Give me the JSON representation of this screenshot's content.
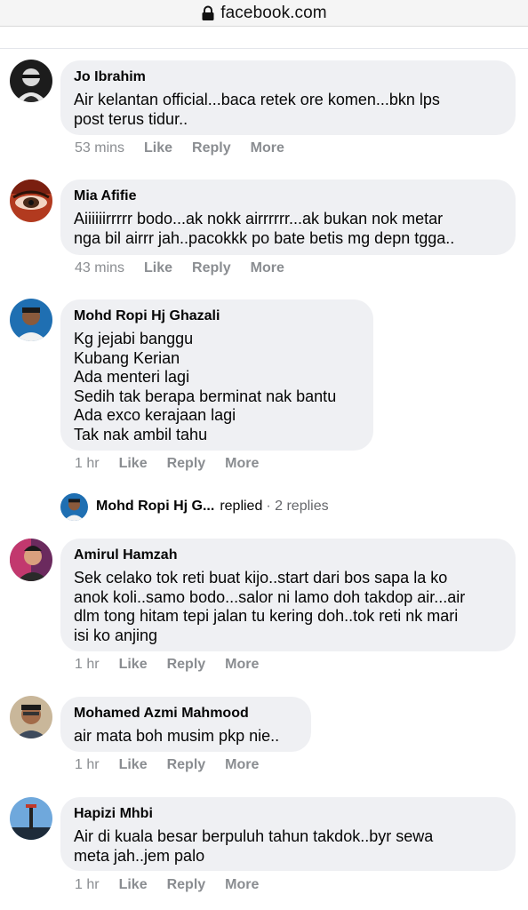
{
  "browser": {
    "domain": "facebook.com"
  },
  "comments": [
    {
      "author": "Jo Ibrahim",
      "text": "Air kelantan official...baca retek ore komen...bkn lps\npost terus tidur..",
      "time": "53 mins",
      "like": "Like",
      "reply": "Reply",
      "more": "More"
    },
    {
      "author": "Mia Afifie",
      "text": "Aiiiiiirrrrr bodo...ak nokk airrrrrr...ak bukan nok metar\nnga bil airrr jah..pacokkk po bate betis mg depn tgga..",
      "time": "43 mins",
      "like": "Like",
      "reply": "Reply",
      "more": "More"
    },
    {
      "author": "Mohd Ropi Hj Ghazali",
      "text": "Kg jejabi banggu\nKubang Kerian\nAda menteri lagi\nSedih tak berapa berminat nak bantu\nAda exco kerajaan lagi\nTak nak ambil tahu",
      "time": "1 hr",
      "like": "Like",
      "reply": "Reply",
      "more": "More"
    },
    {
      "author": "Amirul Hamzah",
      "text": "Sek celako tok reti buat kijo..start dari bos sapa la ko\nanok koli..samo bodo...salor ni lamo doh takdop air...air\ndlm tong hitam tepi jalan tu kering doh..tok reti nk mari\nisi ko anjing",
      "time": "1 hr",
      "like": "Like",
      "reply": "Reply",
      "more": "More"
    },
    {
      "author": "Mohamed Azmi Mahmood",
      "text": "air mata boh musim pkp nie..",
      "time": "1 hr",
      "like": "Like",
      "reply": "Reply",
      "more": "More"
    },
    {
      "author": "Hapizi Mhbi",
      "text": "Air di kuala besar berpuluh tahun takdok..byr sewa\nmeta jah..jem palo",
      "time": "1 hr",
      "like": "Like",
      "reply": "Reply",
      "more": "More"
    }
  ],
  "reply_summary": {
    "name": "Mohd Ropi Hj G...",
    "verb": "replied",
    "count": "· 2 replies"
  }
}
